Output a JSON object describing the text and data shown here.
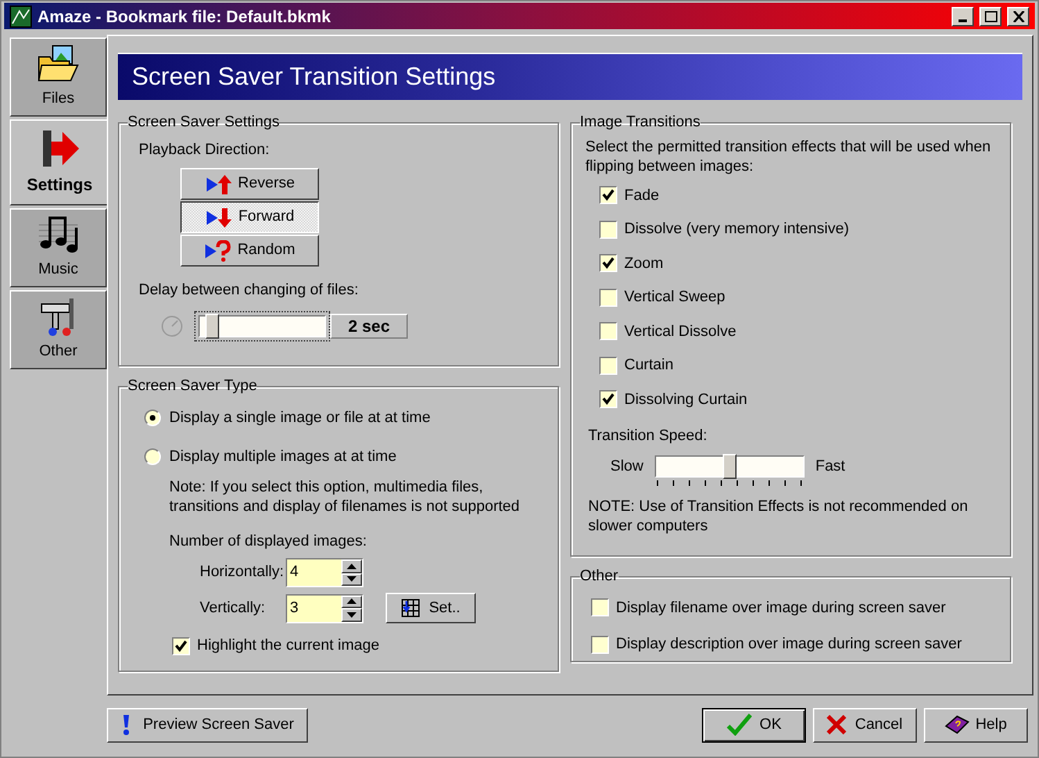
{
  "window": {
    "title": "Amaze - Bookmark file: Default.bkmk"
  },
  "sidebar": {
    "tabs": [
      {
        "label": "Files",
        "kind": "files",
        "selected": false
      },
      {
        "label": "Settings",
        "kind": "settings",
        "selected": true
      },
      {
        "label": "Music",
        "kind": "music",
        "selected": false
      },
      {
        "label": "Other",
        "kind": "other",
        "selected": false
      }
    ]
  },
  "header": {
    "title": "Screen Saver Transition Settings"
  },
  "screen_saver_settings": {
    "title": "Screen Saver Settings",
    "playback_label": "Playback Direction:",
    "directions": [
      {
        "label": "Reverse",
        "kind": "reverse",
        "selected": false
      },
      {
        "label": "Forward",
        "kind": "forward",
        "selected": true
      },
      {
        "label": "Random",
        "kind": "random",
        "selected": false
      }
    ],
    "delay_label": "Delay between changing of files:",
    "delay": {
      "level": 0.05,
      "reading": "2 sec"
    }
  },
  "screen_saver_type": {
    "title": "Screen Saver Type",
    "options": [
      {
        "label": "Display a single image or file at at time",
        "selected": true
      },
      {
        "label": "Display multiple images at at time",
        "selected": false
      }
    ],
    "note": "Note:  If you select this option, multimedia files, transitions and display of filenames is not supported",
    "count_label": "Number of displayed images:",
    "horizontal": {
      "label": "Horizontally:",
      "value": "4"
    },
    "vertical": {
      "label": "Vertically:",
      "value": "3"
    },
    "set_button": "Set..",
    "highlight": {
      "label": "Highlight the current image",
      "checked": true
    }
  },
  "image_transitions": {
    "title": "Image Transitions",
    "intro": "Select the permitted transition effects that will be used when flipping between images:",
    "effects": [
      {
        "label": "Fade",
        "checked": true
      },
      {
        "label": "Dissolve (very memory intensive)",
        "checked": false
      },
      {
        "label": "Zoom",
        "checked": true
      },
      {
        "label": "Vertical Sweep",
        "checked": false
      },
      {
        "label": "Vertical Dissolve",
        "checked": false
      },
      {
        "label": "Curtain",
        "checked": false
      },
      {
        "label": "Dissolving Curtain",
        "checked": true
      }
    ],
    "speed_label": "Transition Speed:",
    "slow": "Slow",
    "fast": "Fast",
    "speed": {
      "level": 0.5
    },
    "note": "NOTE: Use of Transition Effects is not recommended on slower computers"
  },
  "other": {
    "title": "Other",
    "options": [
      {
        "label": "Display filename over image during screen saver",
        "checked": false
      },
      {
        "label": "Display description over image during screen saver",
        "checked": false
      }
    ]
  },
  "buttons": {
    "preview": "Preview Screen Saver",
    "ok": "OK",
    "cancel": "Cancel",
    "help": "Help"
  }
}
